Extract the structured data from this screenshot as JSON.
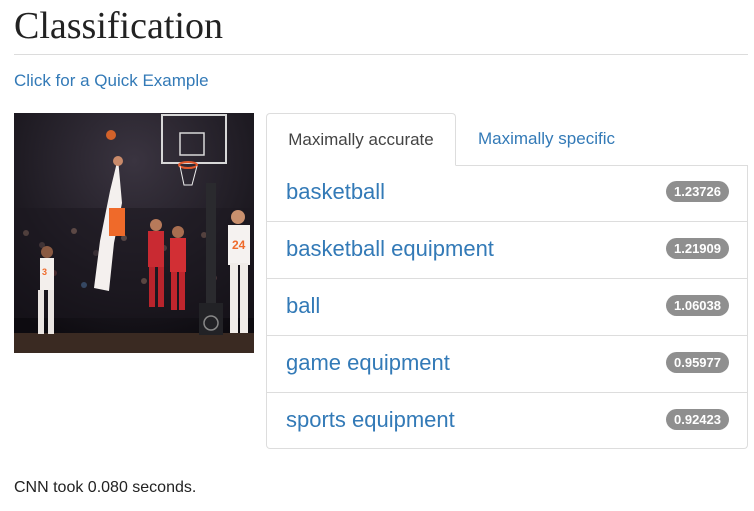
{
  "page": {
    "title": "Classification",
    "quick_example_link": "Click for a Quick Example",
    "timing": "CNN took 0.080 seconds."
  },
  "image": {
    "description_icon": "photo-icon",
    "jersey_numbers": [
      "3",
      "24"
    ]
  },
  "tabs": [
    {
      "label": "Maximally accurate",
      "active": true
    },
    {
      "label": "Maximally specific",
      "active": false
    }
  ],
  "results": [
    {
      "label": "basketball",
      "score": "1.23726"
    },
    {
      "label": "basketball equipment",
      "score": "1.21909"
    },
    {
      "label": "ball",
      "score": "1.06038"
    },
    {
      "label": "game equipment",
      "score": "0.95977"
    },
    {
      "label": "sports equipment",
      "score": "0.92423"
    }
  ],
  "colors": {
    "link": "#337ab7",
    "badge": "#8f8f8f",
    "border": "#dddddd"
  }
}
